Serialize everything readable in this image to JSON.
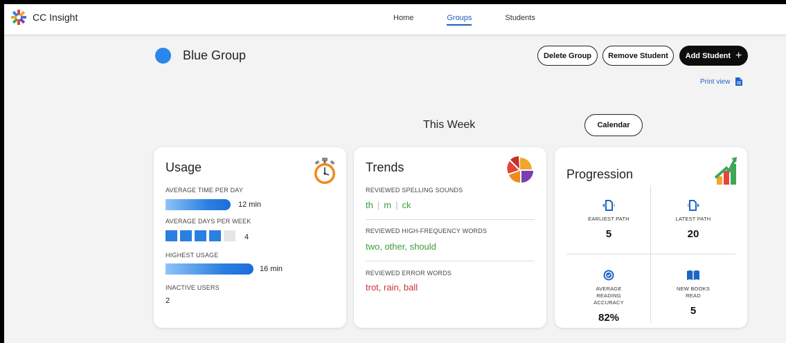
{
  "app": {
    "name": "CC Insight"
  },
  "nav": {
    "items": [
      "Home",
      "Groups",
      "Students"
    ],
    "active": "Groups"
  },
  "group": {
    "name": "Blue Group",
    "color": "#2a86ea"
  },
  "actions": {
    "delete": "Delete Group",
    "remove": "Remove Student",
    "add": "Add Student",
    "add_plus": "+",
    "print": "Print view"
  },
  "period": {
    "label": "This Week",
    "calendar": "Calendar"
  },
  "usage": {
    "title": "Usage",
    "avg_time_label": "AVERAGE TIME PER DAY",
    "avg_time_value": "12 min",
    "avg_days_label": "AVERAGE DAYS PER WEEK",
    "avg_days_value": "4",
    "avg_days_filled": 4,
    "avg_days_total": 5,
    "highest_label": "HIGHEST USAGE",
    "highest_value": "16 min",
    "inactive_label": "INACTIVE USERS",
    "inactive_value": "2"
  },
  "trends": {
    "title": "Trends",
    "sounds_label": "REVIEWED SPELLING SOUNDS",
    "sounds": [
      "th",
      "m",
      "ck"
    ],
    "hf_label": "REVIEWED HIGH-FREQUENCY WORDS",
    "hf_value": "two, other, should",
    "error_label": "REVIEWED ERROR WORDS",
    "error_value": "trot, rain, ball"
  },
  "progression": {
    "title": "Progression",
    "earliest_label": "EARLIEST PATH",
    "earliest_value": "5",
    "latest_label": "LATEST PATH",
    "latest_value": "20",
    "accuracy_label": "AVERAGE READING ACCURACY",
    "accuracy_value": "82%",
    "books_label": "NEW BOOKS READ",
    "books_value": "5"
  },
  "colors": {
    "accent": "#1d5fb8",
    "bar": "#2b7fe0",
    "green": "#3b9c3b",
    "red": "#c8333b",
    "empty": "#e6e6e6"
  }
}
